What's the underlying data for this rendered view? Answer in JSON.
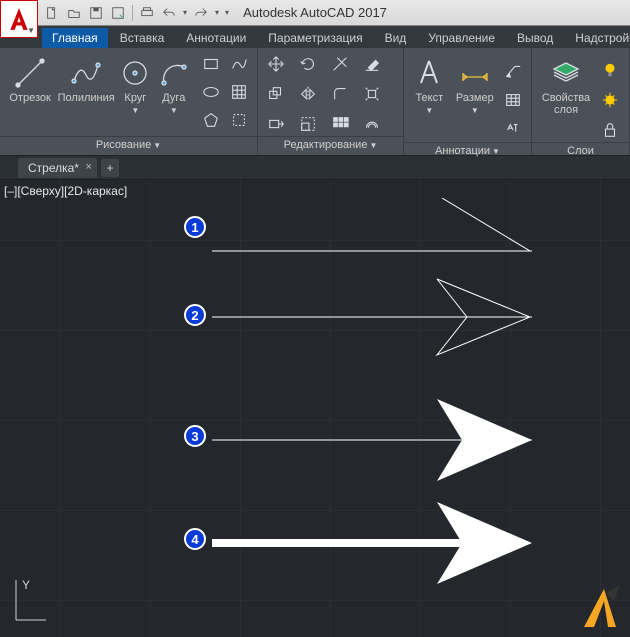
{
  "app": {
    "title": "Autodesk AutoCAD 2017"
  },
  "ribbon": {
    "tabs": [
      "Главная",
      "Вставка",
      "Аннотации",
      "Параметризация",
      "Вид",
      "Управление",
      "Вывод",
      "Надстройки"
    ],
    "active": 0,
    "panels": {
      "draw": {
        "title": "Рисование",
        "segment": {
          "label": "Отрезок"
        },
        "polyline": {
          "label": "Полилиния"
        },
        "circle": {
          "label": "Круг"
        },
        "arc": {
          "label": "Дуга"
        }
      },
      "modify": {
        "title": "Редактирование"
      },
      "anno": {
        "title": "Аннотации",
        "text": {
          "label": "Текст"
        },
        "dim": {
          "label": "Размер"
        }
      },
      "layers": {
        "title": "Слои",
        "props": {
          "label": "Свойства\nслоя"
        }
      }
    }
  },
  "file_tabs": {
    "active": "Стрелка*"
  },
  "canvas": {
    "viewport_label": "[–][Сверху][2D-каркас]",
    "markers": [
      "1",
      "2",
      "3",
      "4"
    ],
    "ucs_y": "Y"
  }
}
